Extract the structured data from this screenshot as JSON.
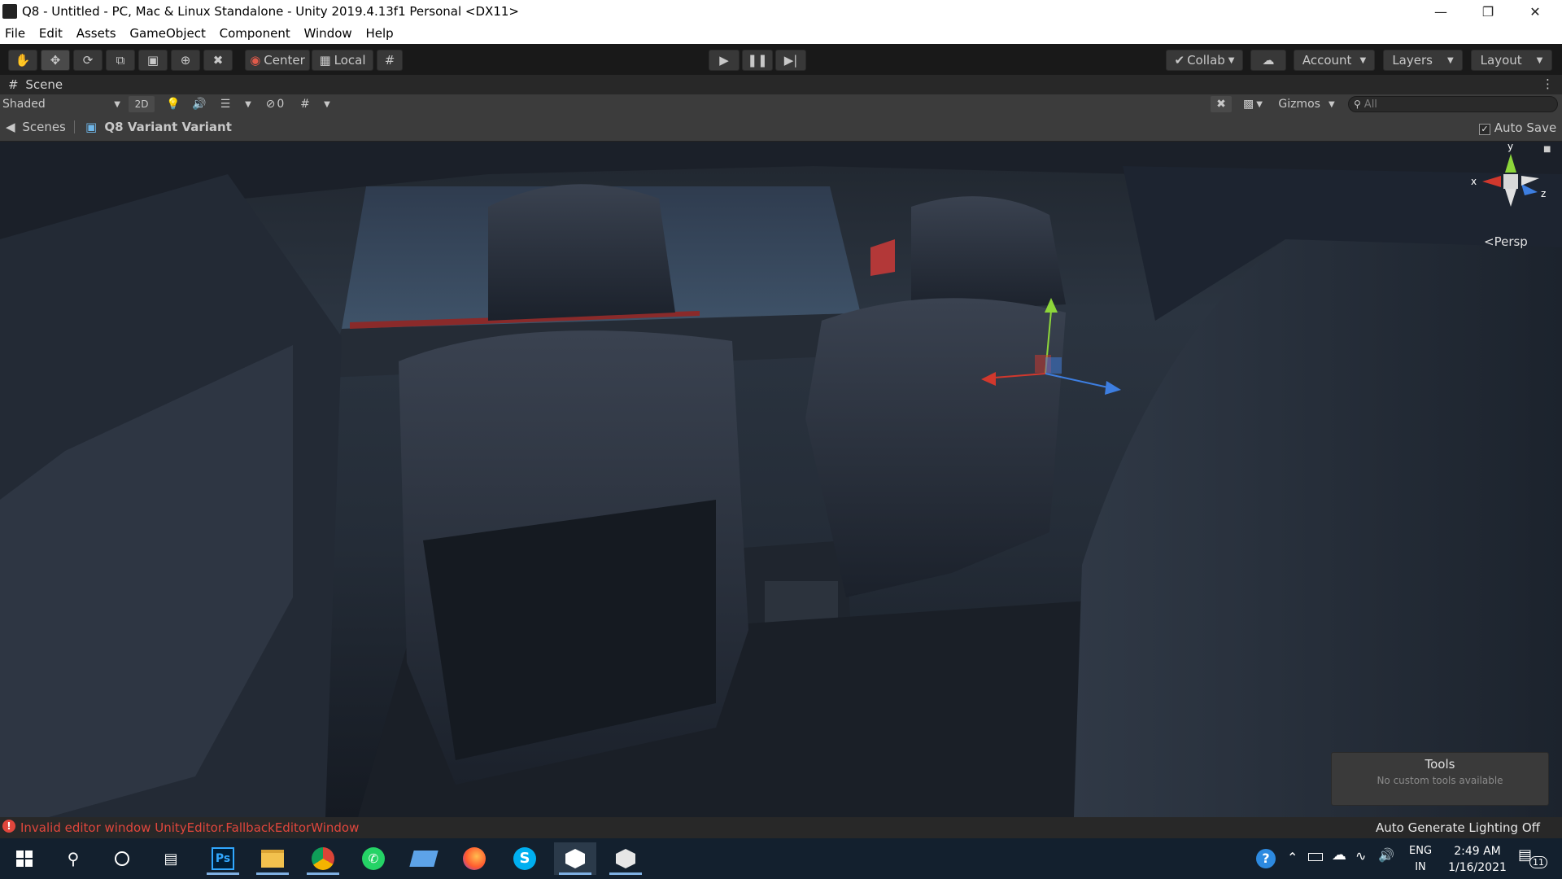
{
  "window": {
    "title": "Q8 - Untitled - PC, Mac & Linux Standalone - Unity 2019.4.13f1 Personal <DX11>",
    "controls": [
      "minimize-icon",
      "restore-icon",
      "close-icon"
    ]
  },
  "menu": [
    "File",
    "Edit",
    "Assets",
    "GameObject",
    "Component",
    "Window",
    "Help"
  ],
  "toolbar": {
    "tools": [
      "hand-tool-icon",
      "move-tool-icon",
      "rotate-tool-icon",
      "scale-tool-icon",
      "rect-tool-icon",
      "transform-tool-icon",
      "custom-tool-icon"
    ],
    "pivot_label": "Center",
    "space_label": "Local",
    "collab_label": "Collab",
    "account_label": "Account",
    "layers_label": "Layers",
    "layout_label": "Layout"
  },
  "scene_tab": {
    "label": "Scene"
  },
  "scene_bar": {
    "shading": "Shaded",
    "mode_2d": "2D",
    "hidden_count": "0",
    "gizmos_label": "Gizmos",
    "search_placeholder": "All"
  },
  "breadcrumb": {
    "root": "Scenes",
    "prefab": "Q8 Variant Variant",
    "auto_save_label": "Auto Save",
    "auto_save_checked": true
  },
  "viewport": {
    "axis_labels": {
      "x": "x",
      "y": "y",
      "z": "z"
    },
    "projection": "Persp",
    "tools_panel": {
      "title": "Tools",
      "message": "No custom tools available"
    }
  },
  "status": {
    "error": "Invalid editor window UnityEditor.FallbackEditorWindow",
    "lighting": "Auto Generate Lighting Off"
  },
  "taskbar": {
    "apps": [
      "windows-start-icon",
      "search-icon",
      "cortana-icon",
      "task-view-icon",
      "photoshop-icon",
      "file-explorer-icon",
      "chrome-icon",
      "whatsapp-icon",
      "network-drive-icon",
      "firefox-icon",
      "skype-icon",
      "unity-icon",
      "unity-hub-icon"
    ],
    "photoshop_label": "Ps",
    "skype_label": "S",
    "language_top": "ENG",
    "language_bottom": "IN",
    "time": "2:49 AM",
    "date": "1/16/2021",
    "notification_count": "11"
  },
  "colors": {
    "error": "#e0463c",
    "toolbar_bg": "#191919",
    "panel_bg": "#3c3c3c",
    "taskbar_bg": "#13202e",
    "gizmo_x": "#d1382d",
    "gizmo_y": "#8dd63a",
    "gizmo_z": "#3d7ee0"
  }
}
